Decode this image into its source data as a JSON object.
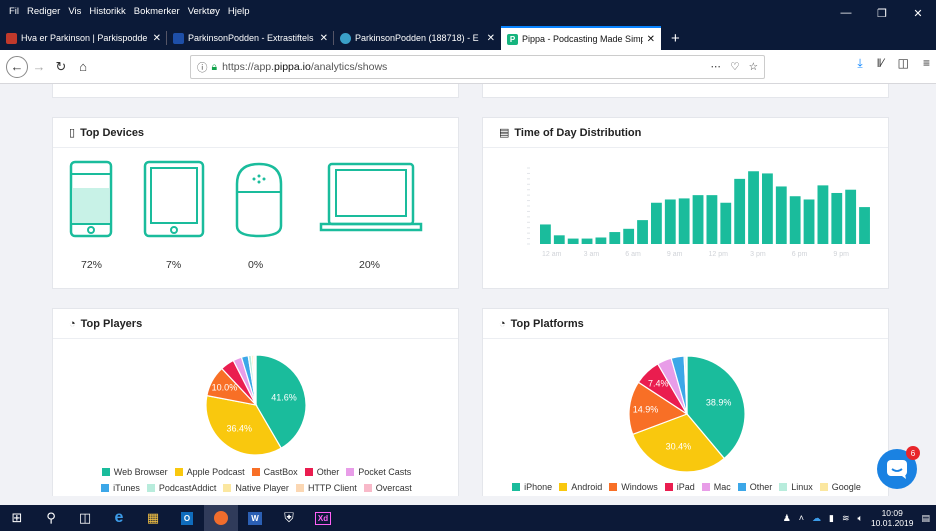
{
  "menubar": {
    "items": [
      "Fil",
      "Rediger",
      "Vis",
      "Historikk",
      "Bokmerker",
      "Verktøy",
      "Hjelp"
    ]
  },
  "tabs": [
    {
      "title": "Hva er Parkinson | Parkispodde",
      "favicon_color": "#c0392b"
    },
    {
      "title": "ParkinsonPodden - Extrastiftels",
      "favicon_color": "#1e4fa8"
    },
    {
      "title": "ParkinsonPodden (188718) - E",
      "favicon_color": "#3aa0c8"
    },
    {
      "title": "Pippa - Podcasting Made Simpl",
      "favicon_color": "#16b47e",
      "favicon_glyph": "P"
    }
  ],
  "navbar": {
    "url_prefix": "https://app.",
    "url_domain": "pippa.io",
    "url_path": "/analytics/shows"
  },
  "devices": {
    "title": "Top Devices",
    "items": [
      {
        "name": "Phone",
        "percent": "72%",
        "fill": 0.72
      },
      {
        "name": "Tablet",
        "percent": "7%",
        "fill": 0.07
      },
      {
        "name": "Smart speaker",
        "percent": "0%",
        "fill": 0.0
      },
      {
        "name": "Desktop",
        "percent": "20%",
        "fill": 0.2
      }
    ],
    "color": "#1abc9c"
  },
  "time_of_day": {
    "title": "Time of Day Distribution"
  },
  "chart_data": [
    {
      "type": "bar",
      "title": "Time of Day Distribution",
      "x_tick_labels": [
        "12 am",
        "3 am",
        "6 am",
        "9 am",
        "12 pm",
        "3 pm",
        "6 pm",
        "9 pm"
      ],
      "values": [
        18,
        8,
        5,
        5,
        6,
        11,
        14,
        22,
        38,
        41,
        42,
        45,
        45,
        38,
        60,
        67,
        65,
        53,
        44,
        41,
        54,
        47,
        50,
        34
      ],
      "ylim": [
        0,
        70
      ],
      "color": "#1abc9c"
    },
    {
      "type": "pie",
      "title": "Top Players",
      "series": [
        {
          "name": "Web Browser",
          "value": 41.6,
          "color": "#1abc9c"
        },
        {
          "name": "Apple Podcast",
          "value": 36.4,
          "color": "#f9c80e"
        },
        {
          "name": "CastBox",
          "value": 10.0,
          "color": "#f86f26"
        },
        {
          "name": "Other",
          "value": 4.5,
          "color": "#ea1d4f"
        },
        {
          "name": "Pocket Casts",
          "value": 2.8,
          "color": "#e89de8"
        },
        {
          "name": "iTunes",
          "value": 2.2,
          "color": "#3ca7e8"
        },
        {
          "name": "PodcastAddict",
          "value": 1.0,
          "color": "#b8ecdc"
        },
        {
          "name": "Native Player",
          "value": 0.6,
          "color": "#fbe7a0"
        },
        {
          "name": "HTTP Client",
          "value": 0.5,
          "color": "#fbd7b3"
        },
        {
          "name": "Overcast",
          "value": 0.4,
          "color": "#f8b9c9"
        }
      ]
    },
    {
      "type": "pie",
      "title": "Top Platforms",
      "series": [
        {
          "name": "iPhone",
          "value": 38.9,
          "color": "#1abc9c"
        },
        {
          "name": "Android",
          "value": 30.4,
          "color": "#f9c80e"
        },
        {
          "name": "Windows",
          "value": 14.9,
          "color": "#f86f26"
        },
        {
          "name": "iPad",
          "value": 7.4,
          "color": "#ea1d4f"
        },
        {
          "name": "Mac",
          "value": 4.0,
          "color": "#e89de8"
        },
        {
          "name": "Other",
          "value": 3.6,
          "color": "#3ca7e8"
        },
        {
          "name": "Linux",
          "value": 0.5,
          "color": "#b8ecdc"
        },
        {
          "name": "Google",
          "value": 0.3,
          "color": "#fbe7a0"
        }
      ]
    }
  ],
  "players": {
    "title": "Top Players",
    "legend_rows": [
      [
        "Web Browser",
        "Apple Podcast",
        "CastBox",
        "Other",
        "Pocket Casts"
      ],
      [
        "iTunes",
        "PodcastAddict",
        "Native Player",
        "HTTP Client",
        "Overcast"
      ]
    ],
    "shown_labels": [
      "41.6%",
      "36.4%",
      "10.0%"
    ]
  },
  "platforms": {
    "title": "Top Platforms",
    "legend_rows": [
      [
        "iPhone",
        "Android",
        "Windows",
        "iPad",
        "Mac",
        "Other",
        "Linux",
        "Google"
      ]
    ],
    "shown_labels": [
      "38.9%",
      "30.4%",
      "14.9%",
      "7.4%"
    ]
  },
  "chat": {
    "badge": "6"
  },
  "taskbar": {
    "time": "10:09",
    "date": "10.01.2019"
  }
}
